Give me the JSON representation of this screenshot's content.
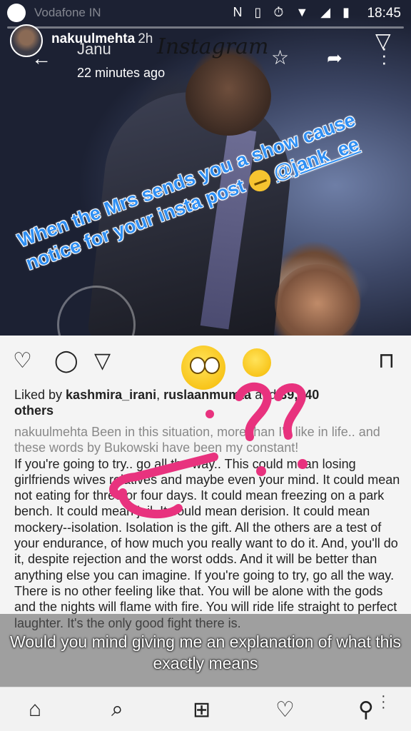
{
  "status_bar": {
    "carrier": "Vodafone IN",
    "time": "18:45"
  },
  "story": {
    "username": "nakuulmehta",
    "age": "2h"
  },
  "embedded_app": {
    "chat_title": "Janu",
    "app_logo": "Instagram",
    "subtitle_time": "22 minutes ago"
  },
  "caption": {
    "line1": "When the Mrs sends you a show cause",
    "line2": "notice for your insta post",
    "mention": "@jank_ee"
  },
  "post": {
    "likes_prefix": "Liked by ",
    "liker1": "kashmira_irani",
    "liker2": "ruslaanmumta",
    "likes_count": "39,740",
    "likes_suffix": "others",
    "author_line": "nakuulmehta Been in this situation, more than I'd like in life.. and these words by Bukowski have been my constant!",
    "body": "If you're going to try.. go all the way.. This could mean losing girlfriends wives relatives and maybe even your mind. It could mean not eating for three or four days. It could mean freezing on a park bench. It could mean jail. It could mean derision. It could mean mockery--isolation. Isolation is the gift. All the others are a test of your endurance, of how much you really want to do it. And, you'll do it, despite rejection and the worst odds. And it will be better than anything else you can imagine. If you're going to try, go all the way. There is no other feeling like that. You will be alone with the gods and the nights will flame with fire. You will ride life straight to perfect laughter. It's the only good fight there is."
  },
  "overlay_subtitle": "Would you mind giving me an explanation of what this exactly means",
  "colors": {
    "caption": "#2f8ff3",
    "doodle": "#e8327e"
  }
}
